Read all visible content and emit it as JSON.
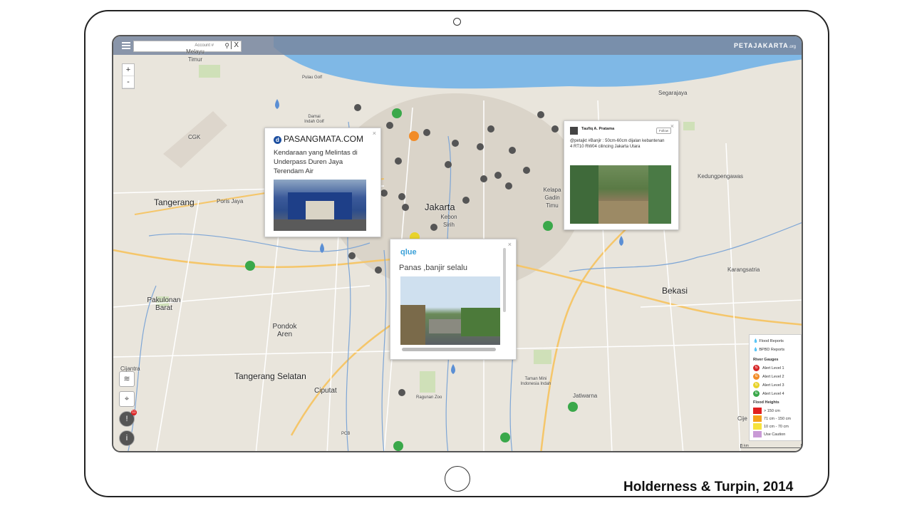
{
  "header": {
    "search_placeholder": "Account #",
    "search_close": "X",
    "brand": "PETAJAKARTA",
    "brand_suffix": ".org",
    "zoom_in": "+",
    "zoom_out": "-"
  },
  "places": {
    "jakarta": "Jakarta",
    "tangerang": "Tangerang",
    "bekasi": "Bekasi",
    "tangerang_selatan": "Tangerang Selatan",
    "pondok_aren": "Pondok Aren",
    "pakulonan_barat": "Pakulonan Barat",
    "ciputat": "Ciputat",
    "cijantra": "Cijantra",
    "kebon_sirih": "Kebon Sirih",
    "poris_jaya": "Poris Jaya",
    "segarajaya": "Segarajaya",
    "kedungpengawas": "Kedungpengawas",
    "karangsatria": "Karangsatria",
    "jatiwarna": "Jatiwarna",
    "pulau_golf": "Pulau Golf",
    "cgk": "CGK",
    "melayu_timur": "Melayu Timur",
    "kelapa_gading": "Kelapa Gadin Timu",
    "taman_mini": "Taman Mini Indonesia Indah",
    "ragunan": "Ragunan Zoo",
    "cije": "Cije",
    "pcb": "PCB",
    "damai_indah": "Damai Indah Golf"
  },
  "popups": {
    "pasangmata": {
      "logo": "PASANGMATA.COM",
      "text": "Kendaraan yang Melintas di Underpass Duren Jaya Terendam Air",
      "close": "×"
    },
    "qlue": {
      "logo": "qlue",
      "text": "Panas ,banjir selalu",
      "close": "×"
    },
    "twitter": {
      "user": "Taufiq A. Pratama",
      "follow": "Follow",
      "text": "@petajkt #Banjir : 50cm-60cm dijalan kebantenan 4 RT10 RW04 cilincing Jakarta Utara",
      "close": "×"
    }
  },
  "legend": {
    "flood_reports": "Flood Reports",
    "bpbd_reports": "BPBD Reports",
    "river_gauges": "River Gauges",
    "alert_levels": [
      "Alert Level 1",
      "Alert Level 2",
      "Alert Level 3",
      "Alert Level 4"
    ],
    "alert_colors": [
      "#d62728",
      "#f28c28",
      "#e8d32a",
      "#3aa84a"
    ],
    "flood_heights": "Flood Heights",
    "heights": [
      "> 150 cm",
      "71 cm - 150 cm",
      "10 cm - 70 cm",
      "Use Caution"
    ],
    "height_colors": [
      "#e02020",
      "#f5a21b",
      "#f6e23c",
      "#c99ad6"
    ]
  },
  "scale": "5 km",
  "side_controls": {
    "report_badge": "11"
  },
  "caption": "Holderness & Turpin, 2014"
}
